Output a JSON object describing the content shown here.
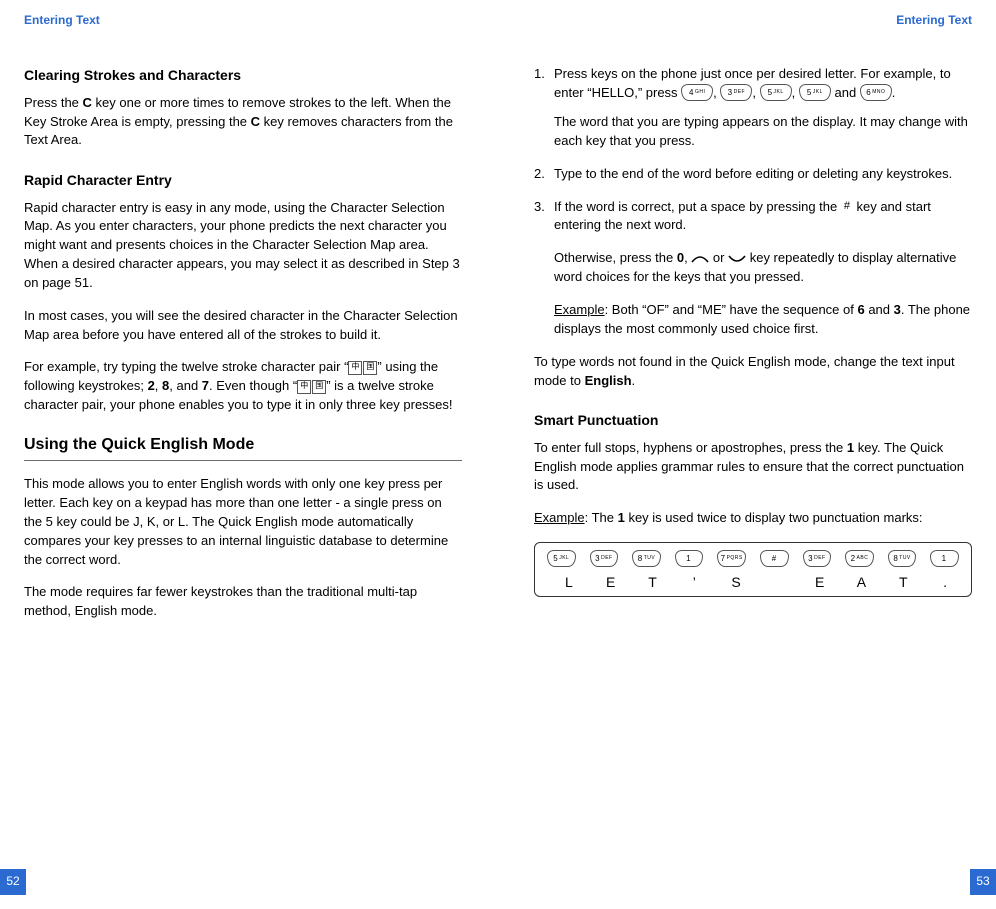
{
  "running_head": {
    "left": "Entering Text",
    "right": "Entering Text"
  },
  "page_numbers": {
    "left": "52",
    "right": "53"
  },
  "left": {
    "h2_clear": "Clearing Strokes and Characters",
    "p_clear_a": "Press the ",
    "p_clear_b": "C",
    "p_clear_c": " key one or more times to remove strokes to the left. When the Key Stroke Area is empty, pressing the ",
    "p_clear_d": "C",
    "p_clear_e": " key removes characters from the Text Area.",
    "h2_rapid": "Rapid Character Entry",
    "p_rapid1": "Rapid character entry is easy in any mode, using the Character Selection Map. As you enter characters, your phone predicts the next character you might want and presents choices in the Character Selection Map area. When a desired character appears, you may select it as described in Step 3 on page 51.",
    "p_rapid2": "In most cases, you will see the desired character in the Character Selection Map area before you have entered all of the strokes to build it.",
    "p_rapid3_a": "For example, try typing the twelve stroke character pair “",
    "p_rapid3_b": "” using the following keystrokes; ",
    "k2": "2",
    "k8": "8",
    "k7": "7",
    "p_rapid3_c": ", and ",
    "p_rapid3_d": ". Even though “",
    "p_rapid3_e": "” is a twelve stroke character pair, your phone enables you to type it in only three key presses!",
    "h1_quick": "Using the Quick English Mode",
    "p_quick1": "This mode allows you to enter English words with only one key press per letter. Each key on a keypad has more than one letter - a single press on the 5 key could be J, K, or L. The Quick English mode automatically compares your key presses to an internal linguistic database to determine the correct word.",
    "p_quick2": "The mode requires far fewer keystrokes than the traditional multi-tap method, English mode.",
    "cjk1": "中",
    "cjk2": "国"
  },
  "right": {
    "step1_a": "Press keys on the phone just once per desired letter. For example, to enter “HELLO,” press ",
    "step1_and": " and ",
    "step1_sub": "The word that you are typing appears on the display. It may change with each key that you press.",
    "step2": "Type to the end of the word before editing or deleting any keystrokes.",
    "step3_a": "If the word is correct, put a space by pressing the ",
    "step3_b": " key and start entering the next word.",
    "step3_sub1_a": "Otherwise, press the ",
    "zero": "0",
    "step3_sub1_b": " or ",
    "step3_sub1_c": " key repeatedly to display alternative word choices for the keys that you pressed.",
    "step3_sub2_a": "Example",
    "step3_sub2_b": ": Both “OF” and “ME” have the sequence of ",
    "six": "6",
    "three": "3",
    "step3_sub2_c": ". The phone displays the most commonly used choice first.",
    "p_outside_a": "To type words not found in the Quick English mode, change the text input mode to ",
    "english_b": "English",
    "p_outside_b": ".",
    "h2_smart": "Smart Punctuation",
    "p_smart_a": "To enter full stops, hyphens or apostrophes, press the ",
    "one": "1",
    "p_smart_b": " key. The Quick English mode applies grammar rules to ensure that the correct punctuation is used.",
    "p_ex_a": "Example",
    "p_ex_b": ": The ",
    "p_ex_c": " key is used twice to display two punctuation marks:",
    "keys": {
      "k4": "4",
      "k4l": "GHI",
      "k3": "3",
      "k3l": "DEF",
      "k5": "5",
      "k5l": "JKL",
      "k6": "6",
      "k6l": "MNO",
      "k8": "8",
      "k8l": "TUV",
      "k1": "1",
      "k1l": "",
      "k7": "7",
      "k7l": "PQRS",
      "k2": "2",
      "k2l": "ABC",
      "hash": "#"
    },
    "letters": {
      "l1": "L",
      "l2": "E",
      "l3": "T",
      "l4": "’",
      "l5": "S",
      "l6": "",
      "l7": "E",
      "l8": "A",
      "l9": "T",
      "l10": "."
    }
  }
}
